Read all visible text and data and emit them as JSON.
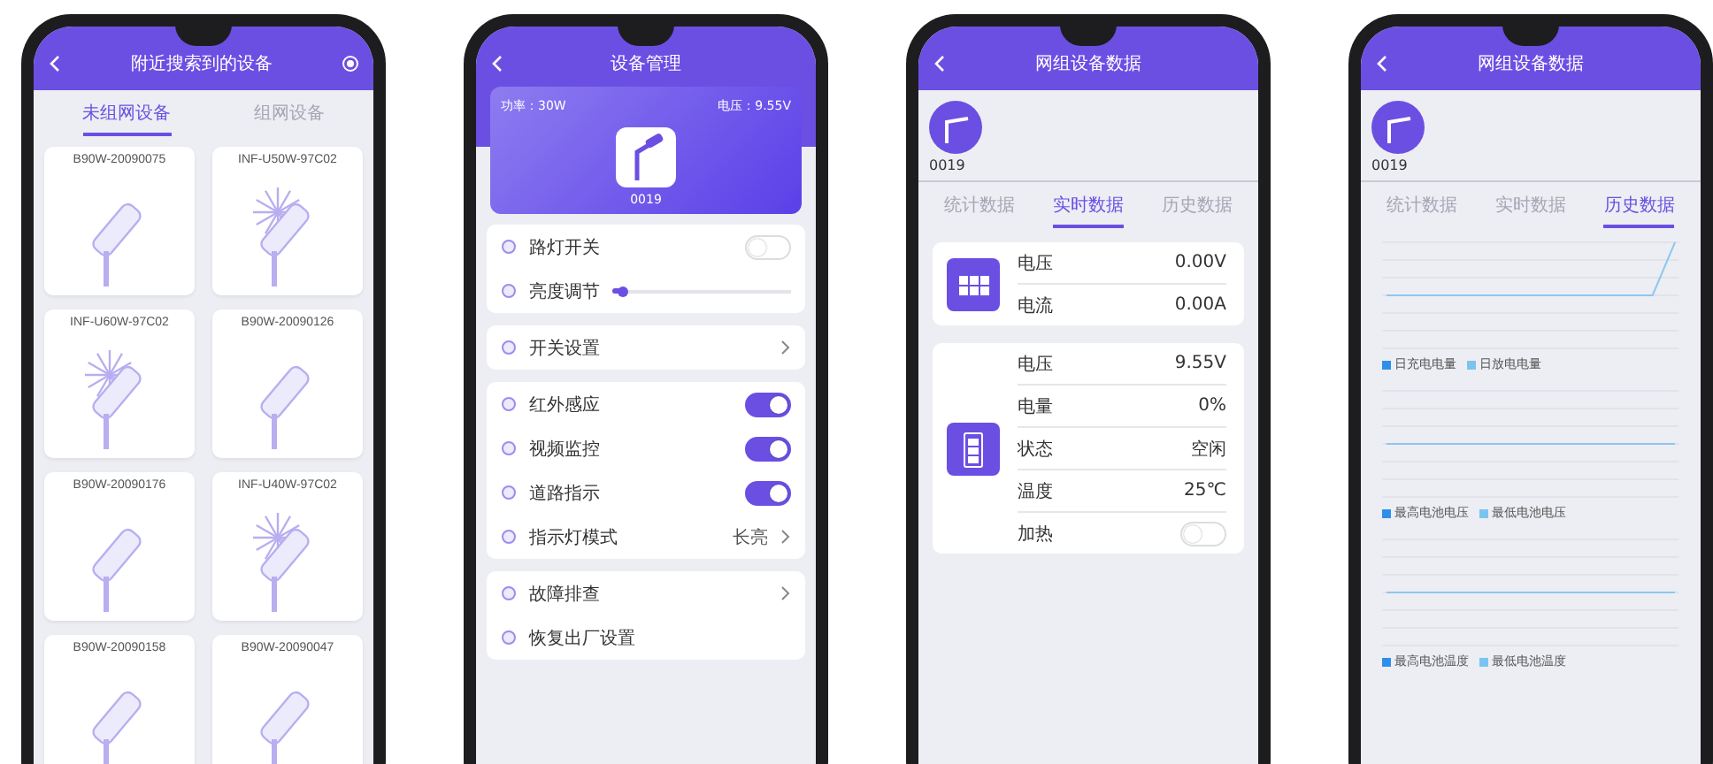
{
  "search_screen": {
    "title": "附近搜索到的设备",
    "tabs": [
      {
        "label": "未组网设备",
        "selected": true
      },
      {
        "label": "组网设备",
        "selected": false
      }
    ],
    "devices": [
      {
        "name": "B90W-20090075",
        "kind": "lamp"
      },
      {
        "name": "INF-U50W-97C02",
        "kind": "wind"
      },
      {
        "name": "INF-U60W-97C02",
        "kind": "wind"
      },
      {
        "name": "B90W-20090126",
        "kind": "lamp"
      },
      {
        "name": "B90W-20090176",
        "kind": "lamp"
      },
      {
        "name": "INF-U40W-97C02",
        "kind": "wind"
      },
      {
        "name": "B90W-20090158",
        "kind": "lamp"
      },
      {
        "name": "B90W-20090047",
        "kind": "lamp"
      }
    ]
  },
  "manage_screen": {
    "title": "设备管理",
    "power": "功率：30W",
    "voltage": "电压：9.55V",
    "device_id": "0019",
    "groups": [
      [
        {
          "kind": "toggle",
          "label": "路灯开关",
          "on": false
        },
        {
          "kind": "slider",
          "label": "亮度调节",
          "level": 0.06
        }
      ],
      [
        {
          "kind": "link",
          "label": "开关设置"
        }
      ],
      [
        {
          "kind": "toggle",
          "label": "红外感应",
          "on": true
        },
        {
          "kind": "toggle",
          "label": "视频监控",
          "on": true
        },
        {
          "kind": "toggle",
          "label": "道路指示",
          "on": true
        },
        {
          "kind": "link",
          "label": "指示灯模式",
          "value": "长亮"
        }
      ],
      [
        {
          "kind": "link",
          "label": "故障排查"
        },
        {
          "kind": "plain",
          "label": "恢复出厂设置"
        }
      ]
    ]
  },
  "realtime_screen": {
    "title": "网组设备数据",
    "device_id": "0019",
    "tabs": [
      {
        "label": "统计数据",
        "selected": false
      },
      {
        "label": "实时数据",
        "selected": true
      },
      {
        "label": "历史数据",
        "selected": false
      }
    ],
    "cards": [
      {
        "kind": "solar",
        "rows": [
          {
            "label": "电压",
            "value": "0.00V"
          },
          {
            "label": "电流",
            "value": "0.00A"
          }
        ]
      },
      {
        "kind": "battery",
        "rows": [
          {
            "label": "电压",
            "value": "9.55V"
          },
          {
            "label": "电量",
            "value": "0%"
          },
          {
            "label": "状态",
            "value": "空闲"
          },
          {
            "label": "温度",
            "value": "25℃"
          },
          {
            "label": "加热",
            "on": false
          }
        ]
      }
    ]
  },
  "history_screen": {
    "title": "网组设备数据",
    "device_id": "0019",
    "tabs": [
      {
        "label": "统计数据",
        "selected": false
      },
      {
        "label": "实时数据",
        "selected": false
      },
      {
        "label": "历史数据",
        "selected": true
      }
    ],
    "charts": [
      {
        "legend": [
          {
            "label": "日充电电量",
            "color": "#2f8fe8"
          },
          {
            "label": "日放电电量",
            "color": "#7cc4f0"
          }
        ]
      },
      {
        "legend": [
          {
            "label": "最高电池电压",
            "color": "#2f8fe8"
          },
          {
            "label": "最低电池电压",
            "color": "#7cc4f0"
          }
        ]
      },
      {
        "legend": [
          {
            "label": "最高电池温度",
            "color": "#2f8fe8"
          },
          {
            "label": "最低电池温度",
            "color": "#7cc4f0"
          }
        ]
      }
    ]
  }
}
